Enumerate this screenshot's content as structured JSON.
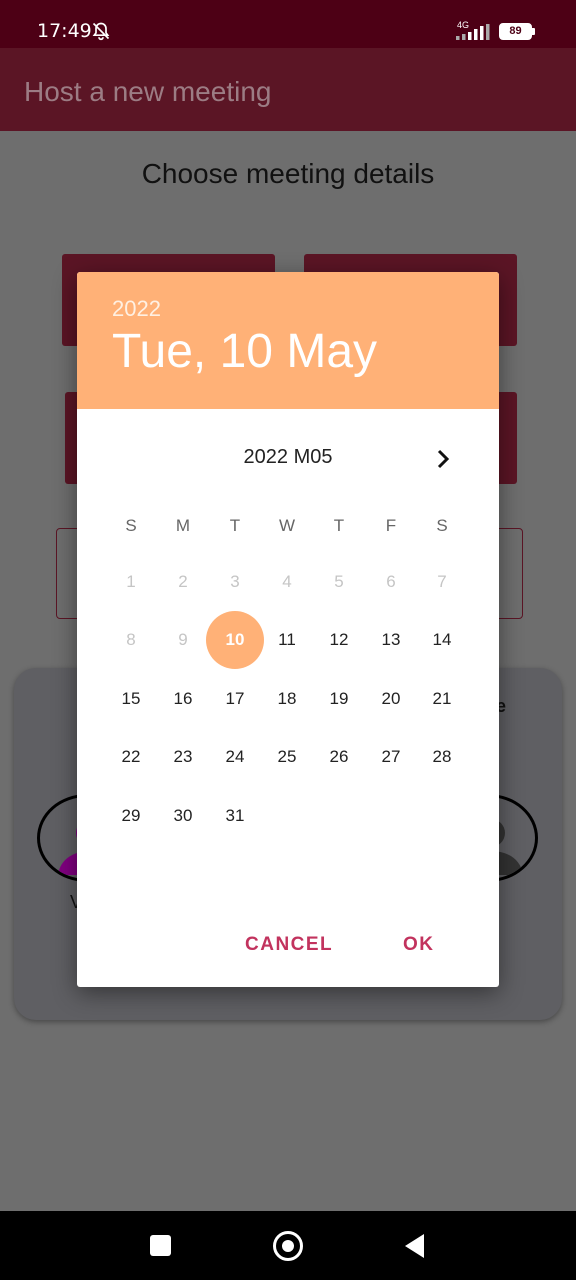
{
  "status_bar": {
    "time": "17:49",
    "network": "4G",
    "battery": "89"
  },
  "app_bar": {
    "title": "Host a new meeting"
  },
  "background": {
    "subtitle": "Choose meeting details",
    "card_fragment_right": "e",
    "card_fragment_left": "V"
  },
  "date_picker": {
    "header_year": "2022",
    "header_date": "Tue, 10 May",
    "month_label": "2022 M05",
    "weekdays": [
      "S",
      "M",
      "T",
      "W",
      "T",
      "F",
      "S"
    ],
    "days": [
      "1",
      "2",
      "3",
      "4",
      "5",
      "6",
      "7",
      "8",
      "9",
      "10",
      "11",
      "12",
      "13",
      "14",
      "15",
      "16",
      "17",
      "18",
      "19",
      "20",
      "21",
      "22",
      "23",
      "24",
      "25",
      "26",
      "27",
      "28",
      "29",
      "30",
      "31"
    ],
    "selected_day": "10",
    "cancel_label": "CANCEL",
    "ok_label": "OK"
  },
  "colors": {
    "accent": "#ffb177",
    "button_text": "#c2335e",
    "app_bar": "#5b1525",
    "status_bar": "#4d0015"
  },
  "icons": {
    "status": [
      "bell-off-icon",
      "signal-icon",
      "battery-icon"
    ],
    "picker": [
      "chevron-right-icon"
    ],
    "nav": [
      "recents-icon",
      "home-icon",
      "back-icon"
    ]
  }
}
